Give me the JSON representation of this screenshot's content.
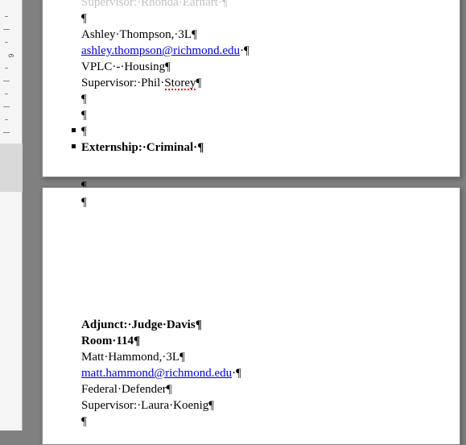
{
  "ruler": {
    "numbers": [
      "9"
    ]
  },
  "glyphs": {
    "pilcrow": "¶",
    "middot": "·"
  },
  "page1": {
    "line0": "Supervisor: Rhonda Earhart",
    "line1_pilcrow": "¶",
    "line2": {
      "name": "Ashley Thompson, 3L",
      "pilcrow": "¶"
    },
    "line3": {
      "email": "ashley.thompson@richmond.edu",
      "after": " ¶"
    },
    "line4": {
      "text": "VPLC - Housing",
      "pilcrow": "¶"
    },
    "line5": {
      "prefix": "Supervisor: Phil ",
      "spell": "Storey",
      "pilcrow": "¶"
    },
    "line6_pilcrow": "¶",
    "line7_pilcrow": "¶",
    "line8_pilcrow": "¶",
    "heading": {
      "text": "Externship: Criminal ",
      "pilcrow": "¶"
    },
    "footer_pilcrow": "¶"
  },
  "page2": {
    "header_pilcrow": "¶",
    "adjunct": {
      "text": "Adjunct: Judge Davis",
      "pilcrow": "¶"
    },
    "room": {
      "text": "Room 114",
      "pilcrow": "¶"
    },
    "student": {
      "text": "Matt Hammond, 3L",
      "pilcrow": "¶"
    },
    "email": {
      "link": "matt.hammond@richmond.edu",
      "after": " ¶"
    },
    "org": {
      "text": "Federal Defender",
      "pilcrow": "¶"
    },
    "supervisor": {
      "text": "Supervisor: Laura Koenig",
      "pilcrow": "¶"
    },
    "trailing_pilcrow": "¶"
  }
}
